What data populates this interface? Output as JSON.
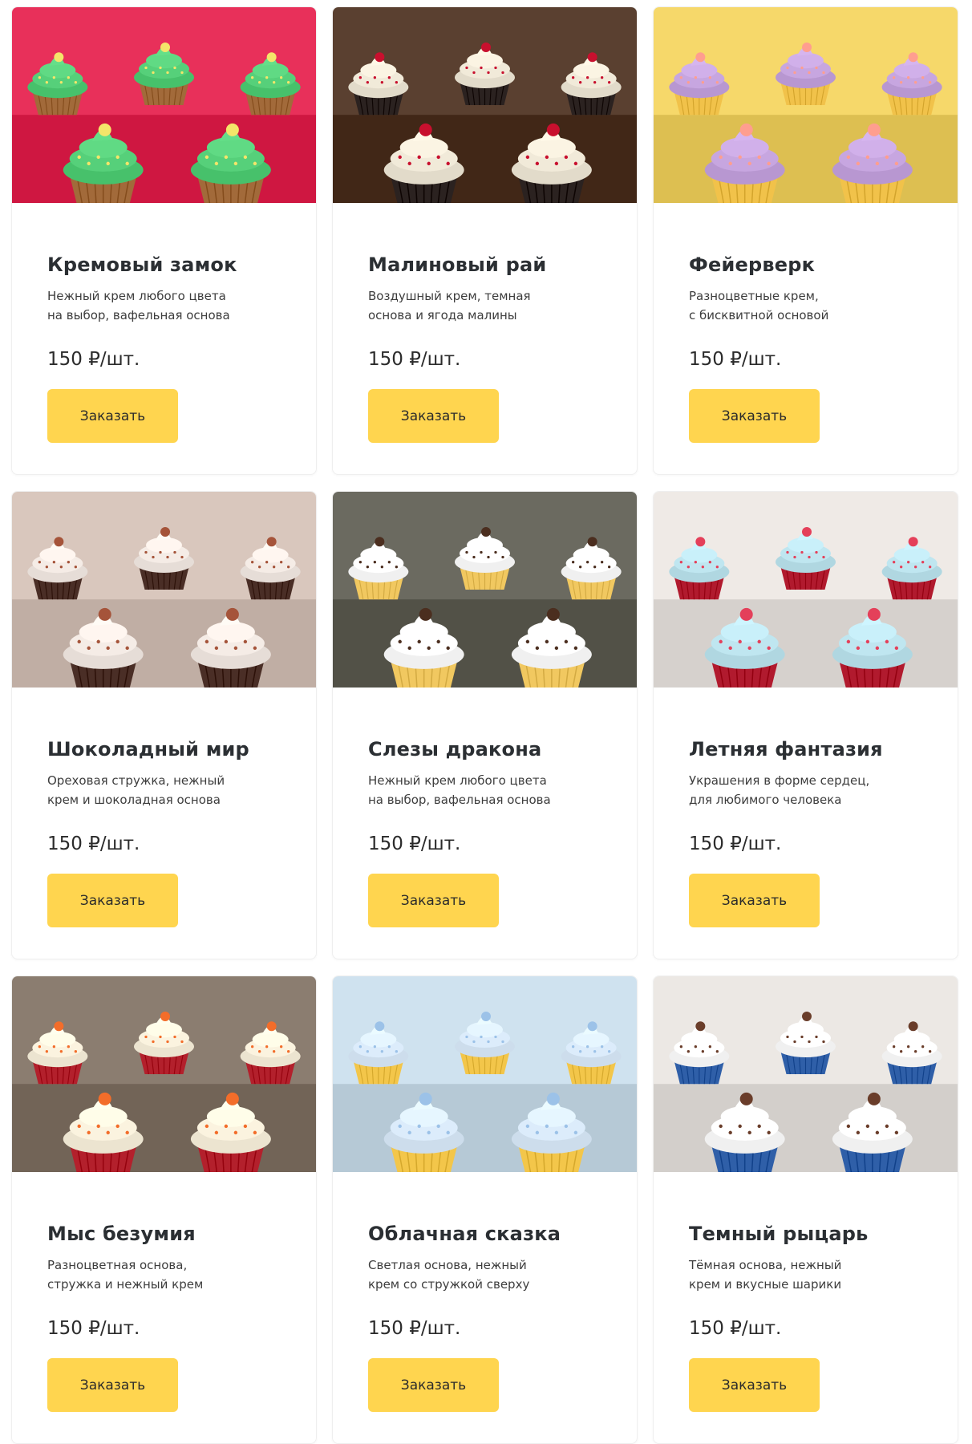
{
  "products": [
    {
      "title": "Кремовый замок",
      "desc_line1": "Нежный крем любого цвета",
      "desc_line2": "на выбор, вафельная основа",
      "price": "150 ₽/шт.",
      "button": "Заказать",
      "bg": "#e8305a",
      "cream": "#56d07a",
      "cup": "#a26a3a",
      "accent": "#f4e56a"
    },
    {
      "title": "Малиновый рай",
      "desc_line1": "Воздушный крем, темная",
      "desc_line2": "основа и ягода малины",
      "price": "150 ₽/шт.",
      "button": "Заказать",
      "bg": "#5a4030",
      "cream": "#f1ead9",
      "cup": "#2b2220",
      "accent": "#c8102e"
    },
    {
      "title": "Фейерверк",
      "desc_line1": "Разноцветные крем,",
      "desc_line2": "с бисквитной основой",
      "price": "150 ₽/шт.",
      "button": "Заказать",
      "bg": "#f6d86a",
      "cream": "#c7a6e0",
      "cup": "#f1c24a",
      "accent": "#ff9e8f"
    },
    {
      "title": "Шоколадный мир",
      "desc_line1": "Ореховая стружка, нежный",
      "desc_line2": "крем и шоколадная основа",
      "price": "150 ₽/шт.",
      "button": "Заказать",
      "bg": "#d9c7bd",
      "cream": "#f5ece6",
      "cup": "#4a2e26",
      "accent": "#a5543a"
    },
    {
      "title": "Слезы дракона",
      "desc_line1": "Нежный крем любого цвета",
      "desc_line2": "на выбор, вафельная основа",
      "price": "150 ₽/шт.",
      "button": "Заказать",
      "bg": "#6b6a60",
      "cream": "#ffffff",
      "cup": "#f1c860",
      "accent": "#4b2e1f"
    },
    {
      "title": "Летняя фантазия",
      "desc_line1": "Украшения в форме сердец,",
      "desc_line2": "для любимого человека",
      "price": "150 ₽/шт.",
      "button": "Заказать",
      "bg": "#efeae6",
      "cream": "#bfe6f0",
      "cup": "#b11a2e",
      "accent": "#e4405a"
    },
    {
      "title": "Мыс безумия",
      "desc_line1": "Разноцветная основа,",
      "desc_line2": "стружка и нежный крем",
      "price": "150 ₽/шт.",
      "button": "Заказать",
      "bg": "#8b7d70",
      "cream": "#fbf3df",
      "cup": "#b3202c",
      "accent": "#f36d2a"
    },
    {
      "title": "Облачная сказка",
      "desc_line1": "Светлая основа, нежный",
      "desc_line2": "крем со стружкой сверху",
      "price": "150 ₽/шт.",
      "button": "Заказать",
      "bg": "#cfe2ef",
      "cream": "#dcecfb",
      "cup": "#f3c64a",
      "accent": "#9cc2e8"
    },
    {
      "title": "Темный рыцарь",
      "desc_line1": "Тёмная основа, нежный",
      "desc_line2": "крем и вкусные шарики",
      "price": "150 ₽/шт.",
      "button": "Заказать",
      "bg": "#ece8e4",
      "cream": "#ffffff",
      "cup": "#2f5fa8",
      "accent": "#6a3d2a"
    }
  ]
}
